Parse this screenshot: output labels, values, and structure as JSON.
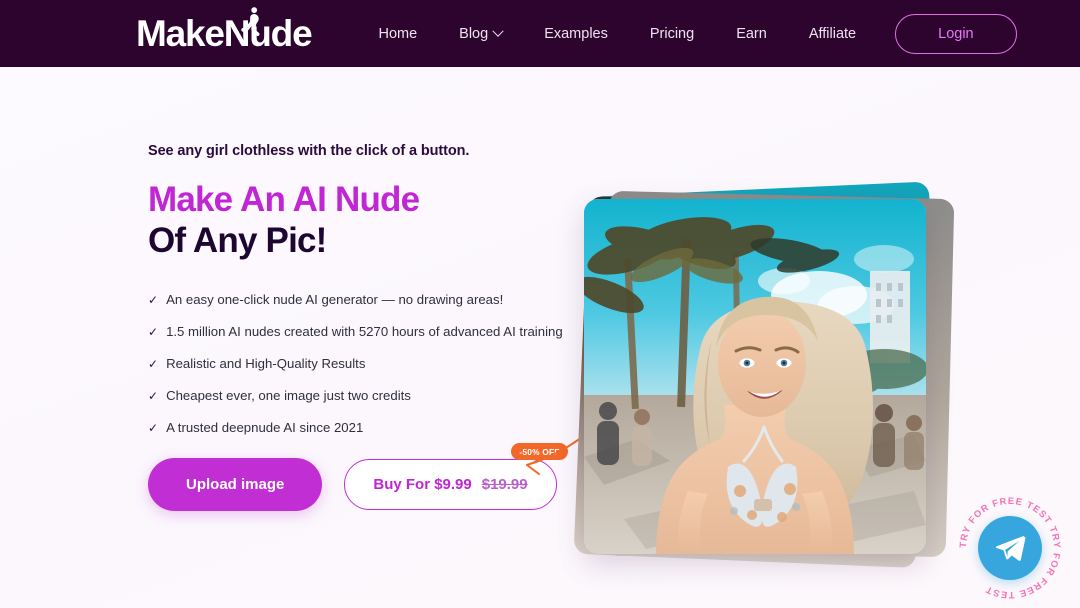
{
  "brand": {
    "logo_text": "MakeNude",
    "logo_icon": "female-silhouette-icon",
    "accent_pink": "#c026d3",
    "header_bg": "#2d042e",
    "login_accent": "#e879f9",
    "badge_orange": "#f2682a",
    "telegram_blue": "#37a6de"
  },
  "header": {
    "nav": [
      {
        "label": "Home",
        "has_chevron": false
      },
      {
        "label": "Blog",
        "has_chevron": true
      },
      {
        "label": "Examples",
        "has_chevron": false
      },
      {
        "label": "Pricing",
        "has_chevron": false
      },
      {
        "label": "Earn",
        "has_chevron": false
      },
      {
        "label": "Affiliate",
        "has_chevron": false
      }
    ],
    "login_label": "Login"
  },
  "hero": {
    "eyebrow": "See any girl clothless with the click of a button.",
    "title_line1": "Make An AI Nude",
    "title_line2": "Of Any Pic!",
    "features": [
      "An easy one-click nude AI generator — no drawing areas!",
      "1.5 million AI nudes created with 5270 hours of advanced AI training",
      "Realistic and High-Quality Results",
      "Cheapest ever, one image just two credits",
      "A trusted deepnude AI since 2021"
    ],
    "check_icon": "check-icon",
    "upload_label": "Upload image",
    "buy_label": "Buy For $9.99",
    "buy_old_price": "$19.99",
    "discount_badge": "-50% OFF",
    "arrow_icon": "curved-arrow-icon",
    "image_alt": "AI generated photo of a smiling blonde woman in a bikini on a tropical beach promenade"
  },
  "floating": {
    "telegram_icon": "telegram-icon",
    "ring_text": "TRY FOR FREE TEST · TRY FOR FREE TEST · "
  }
}
